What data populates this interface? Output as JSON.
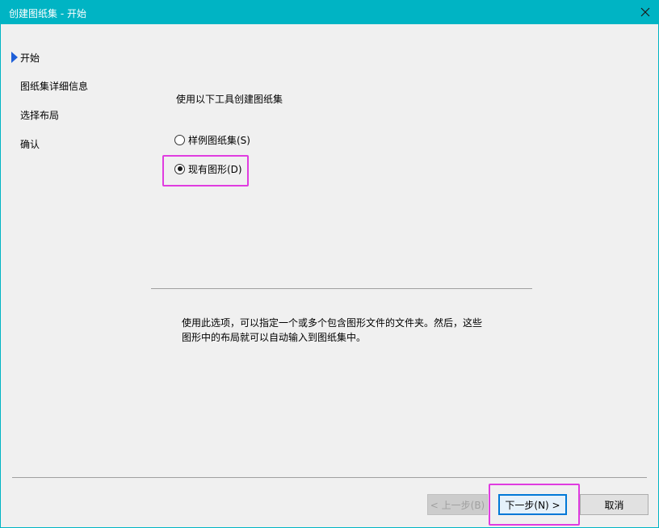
{
  "window": {
    "title": "创建图纸集 - 开始"
  },
  "nav": {
    "items": [
      {
        "label": "开始",
        "current": true
      },
      {
        "label": "图纸集详细信息"
      },
      {
        "label": "选择布局"
      },
      {
        "label": "确认"
      }
    ]
  },
  "main": {
    "instruction": "使用以下工具创建图纸集",
    "options": [
      {
        "label": "样例图纸集(S)",
        "checked": false
      },
      {
        "label": "现有图形(D)",
        "checked": true
      }
    ],
    "description_line1": "使用此选项，可以指定一个或多个包含图形文件的文件夹。然后，这些",
    "description_line2": "图形中的布局就可以自动输入到图纸集中。"
  },
  "footer": {
    "back_label": "< 上一步(B)",
    "next_label": "下一步(N) >",
    "cancel_label": "取消"
  },
  "colors": {
    "titlebar": "#00b4c4",
    "highlight": "#e03ce0",
    "nav_arrow": "#1e5fd8"
  },
  "icons": {
    "close": "close-icon",
    "nav_current": "triangle-right-icon"
  }
}
